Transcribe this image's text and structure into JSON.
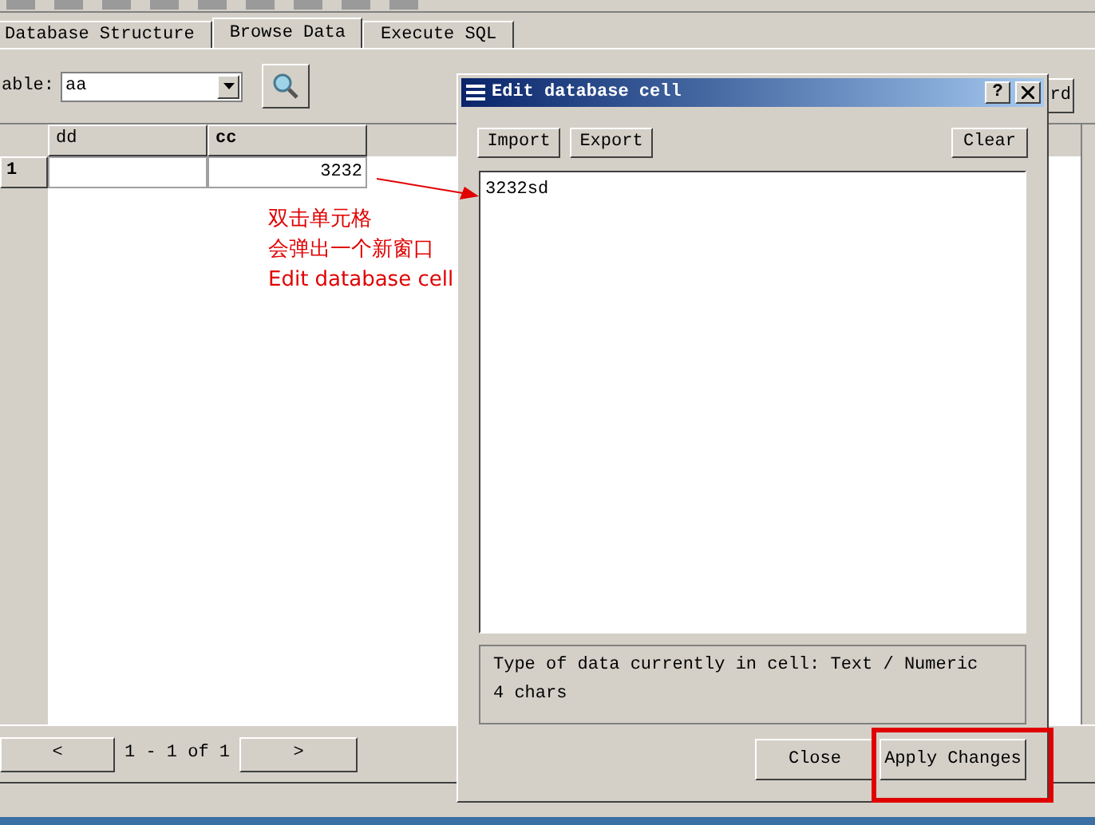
{
  "tabs": [
    {
      "label": "Database Structure",
      "selected": false
    },
    {
      "label": "Browse Data",
      "selected": true
    },
    {
      "label": "Execute SQL",
      "selected": false
    }
  ],
  "table_picker": {
    "label": "able:",
    "value": "aa"
  },
  "partial_button": "rd",
  "grid": {
    "columns": [
      "dd",
      "cc"
    ],
    "rows": [
      {
        "header": "1",
        "cells": [
          {
            "kind": "empty"
          },
          {
            "kind": "text",
            "text": "3232"
          }
        ]
      }
    ]
  },
  "pager": {
    "prev": "<",
    "range": "1 - 1 of 1",
    "next": ">"
  },
  "dialog": {
    "title": "Edit database cell",
    "help": "?",
    "left_buttons": [
      "Import",
      "Export"
    ],
    "clear": "Clear",
    "value": "3232sd",
    "info": [
      "Type of data currently in cell: Text / Numeric",
      "4 chars"
    ],
    "footer_buttons": [
      "Close",
      "Apply Changes"
    ]
  },
  "annotation": {
    "lines": [
      "双击单元格",
      "会弹出一个新窗口",
      "Edit database cell"
    ]
  }
}
